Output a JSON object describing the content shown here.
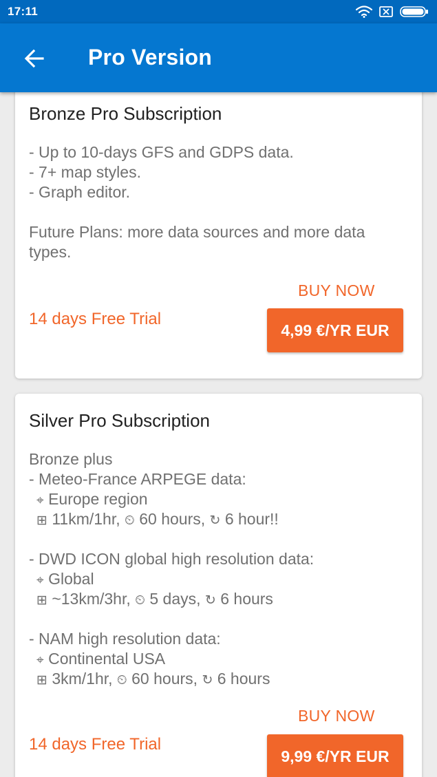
{
  "status_bar": {
    "time": "17:11",
    "icons": [
      "wifi-icon",
      "sim-x-icon",
      "battery-icon"
    ]
  },
  "app_bar": {
    "back_icon": "arrow-left-icon",
    "title": "Pro Version"
  },
  "colors": {
    "status_bar": "#0169be",
    "app_bar": "#0577d0",
    "accent": "#f1662a",
    "title_text": "#212121",
    "body_text": "#707070",
    "background": "#ececec"
  },
  "plans": [
    {
      "title": "Bronze Pro Subscription",
      "description": [
        "- Up to 10-days GFS and GDPS data.",
        "- 7+ map styles.",
        "- Graph editor.",
        "",
        "Future Plans: more data sources and more data",
        "types."
      ],
      "trial": "14 days Free Trial",
      "buy_label": "BUY NOW",
      "price": "4,99 €/YR EUR"
    },
    {
      "title": "Silver Pro Subscription",
      "intro": "Bronze plus",
      "sources": [
        {
          "name": "- Meteo-France ARPEGE data:",
          "region": "Europe region",
          "resolution": "11km/1hr,",
          "duration": "60 hours,",
          "update": "6 hour!!"
        },
        {
          "name": "- DWD ICON global high resolution data:",
          "region": "Global",
          "resolution": "~13km/3hr,",
          "duration": "5 days,",
          "update": "6 hours"
        },
        {
          "name": "- NAM high resolution data:",
          "region": "Continental USA",
          "resolution": "3km/1hr,",
          "duration": "60 hours,",
          "update": "6 hours"
        }
      ],
      "trial": "14 days Free Trial",
      "buy_label": "BUY NOW",
      "price": "9,99 €/YR EUR"
    }
  ]
}
